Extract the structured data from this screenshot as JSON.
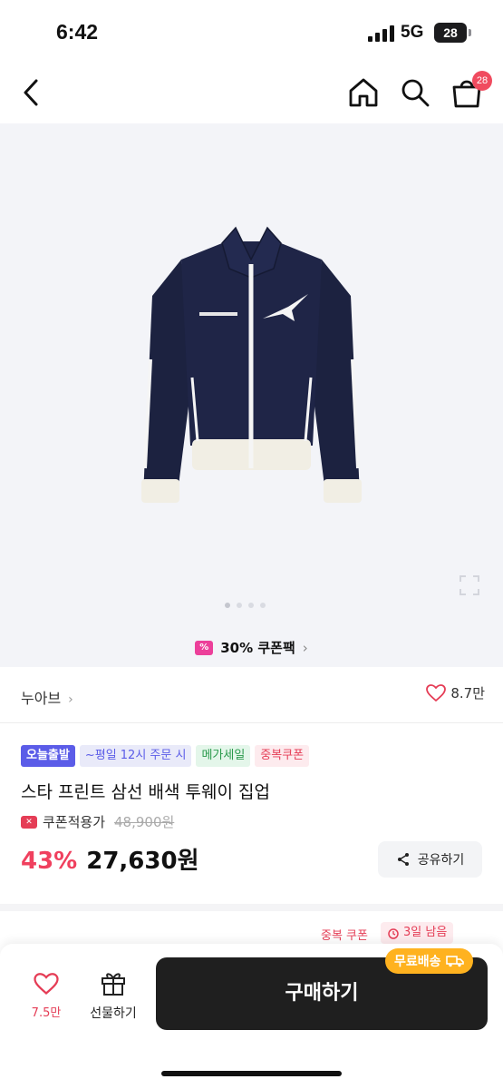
{
  "status": {
    "time": "6:42",
    "network": "5G",
    "battery": "28"
  },
  "nav": {
    "cart_count": "28",
    "icons": [
      "back-icon",
      "home-icon",
      "search-icon",
      "shopping-bag-icon"
    ]
  },
  "coupon_pack": {
    "label": "30% 쿠폰팩",
    "tag": "%"
  },
  "brand": {
    "name": "누아브",
    "like_count": "8.7만"
  },
  "product": {
    "badges": [
      "오늘출발",
      "~평일 12시 주문 시",
      "메가세일",
      "중복쿠폰"
    ],
    "title": "스타 프린트 삼선 배색 투웨이 집업",
    "coupon_label": "쿠폰적용가",
    "original_price": "48,900원",
    "discount": "43%",
    "price": "27,630원",
    "share_label": "공유하기"
  },
  "promo": {
    "dup_coupon": "중복 쿠폰",
    "days_left": "3일 남음"
  },
  "bottom": {
    "like_count": "7.5만",
    "gift_label": "선물하기",
    "buy_label": "구매하기",
    "free_shipping": "무료배송"
  },
  "colors": {
    "accent_red": "#f0405e",
    "badge_purple": "#5b5ce8",
    "buy_button": "#1f1f1f",
    "shipping_orange": "#ffb21f"
  }
}
